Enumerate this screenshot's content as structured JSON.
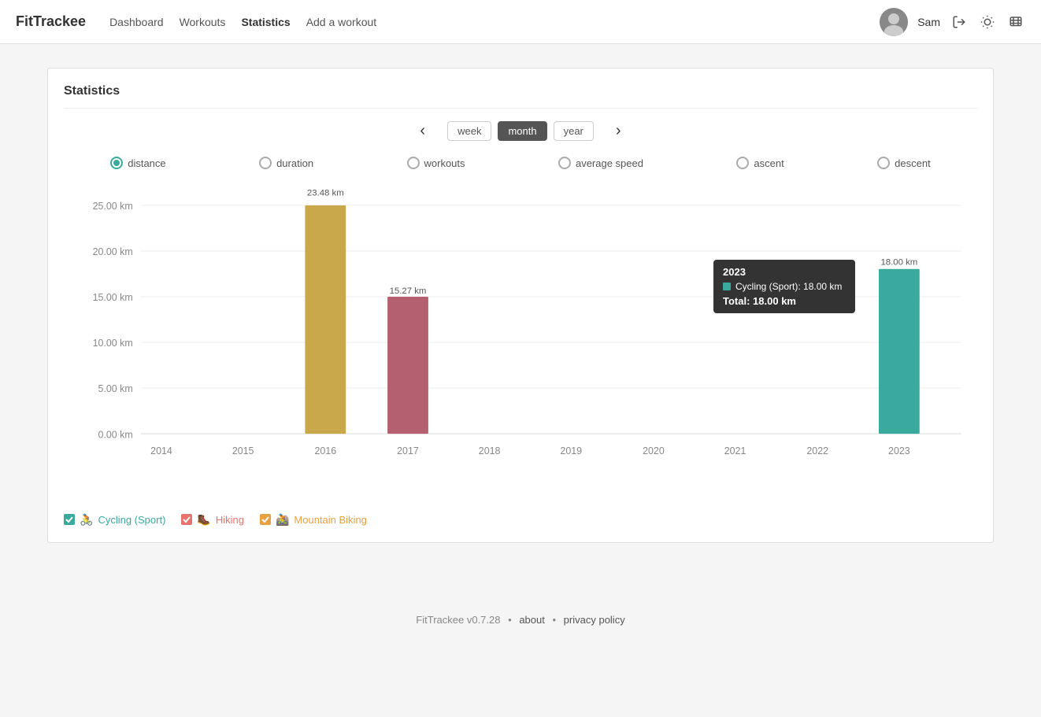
{
  "app": {
    "brand": "FitTrackee",
    "version": "v0.7.28"
  },
  "navbar": {
    "links": [
      {
        "label": "Dashboard",
        "active": false
      },
      {
        "label": "Workouts",
        "active": false
      },
      {
        "label": "Statistics",
        "active": true
      },
      {
        "label": "Add a workout",
        "active": false
      }
    ],
    "username": "Sam",
    "logout_icon": "→",
    "theme_icon": "☀",
    "lang_icon": "🌐"
  },
  "statistics": {
    "title": "Statistics",
    "period_options": [
      {
        "label": "week",
        "active": false
      },
      {
        "label": "month",
        "active": true
      },
      {
        "label": "year",
        "active": false
      }
    ],
    "stat_metrics": [
      {
        "label": "distance",
        "selected": true
      },
      {
        "label": "duration",
        "selected": false
      },
      {
        "label": "workouts",
        "selected": false
      },
      {
        "label": "average speed",
        "selected": false
      },
      {
        "label": "ascent",
        "selected": false
      },
      {
        "label": "descent",
        "selected": false
      }
    ],
    "chart": {
      "y_labels": [
        "25.00 km",
        "20.00 km",
        "15.00 km",
        "10.00 km",
        "5.00 km",
        "0.00 km"
      ],
      "x_labels": [
        "2014",
        "2015",
        "2016",
        "2017",
        "2018",
        "2019",
        "2020",
        "2021",
        "2022",
        "2023"
      ],
      "bars": [
        {
          "year": "2016",
          "value": 23.48,
          "label": "23.48 km",
          "color": "#c9a84c",
          "sport": "Cycling (Sport)"
        },
        {
          "year": "2017",
          "value": 15.27,
          "label": "15.27 km",
          "color": "#b56070",
          "sport": "Hiking"
        },
        {
          "year": "2023",
          "value": 18.0,
          "label": "18.00 km",
          "color": "#3aaa9e",
          "sport": "Cycling (Sport)"
        }
      ],
      "max_value": 25
    },
    "tooltip": {
      "year": "2023",
      "sport": "Cycling (Sport)",
      "sport_value": "18.00 km",
      "sport_color": "#3aaa9e",
      "total_label": "Total:",
      "total_value": "18.00 km"
    },
    "legend": [
      {
        "label": "Cycling (Sport)",
        "color": "#3aaa9e",
        "checked": true,
        "icon": "🚴"
      },
      {
        "label": "Hiking",
        "color": "#e8736e",
        "checked": true,
        "icon": "🥾"
      },
      {
        "label": "Mountain Biking",
        "color": "#e8a040",
        "checked": true,
        "icon": "🚵"
      }
    ]
  },
  "footer": {
    "brand": "FitTrackee",
    "version": "v0.7.28",
    "about_label": "about",
    "privacy_label": "privacy policy"
  }
}
